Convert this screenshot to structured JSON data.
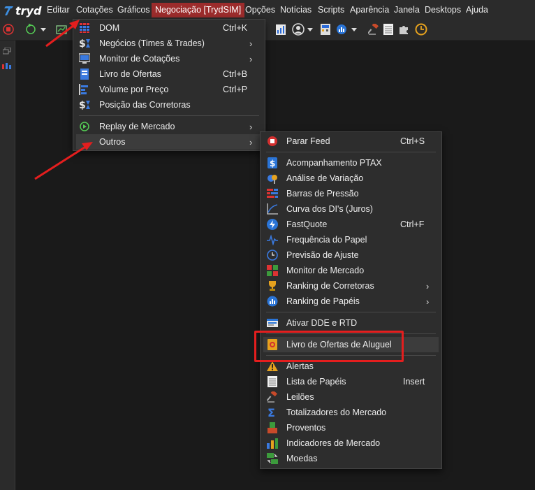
{
  "app": {
    "name": "tryd"
  },
  "menubar": {
    "items": [
      "Editar",
      "Cotações",
      "Gráficos",
      "Negociação [TrydSIM]",
      "Opções",
      "Notícias",
      "Scripts",
      "Aparência",
      "Janela",
      "Desktops",
      "Ajuda"
    ],
    "active_item": "Negociação [TrydSIM]"
  },
  "cotacoes_menu": {
    "items": [
      {
        "label": "DOM",
        "shortcut": "Ctrl+K",
        "icon": "dom-grid-icon"
      },
      {
        "label": "Negócios (Times & Trades)",
        "submenu": true,
        "icon": "dollar-hourglass-icon"
      },
      {
        "label": "Monitor de Cotações",
        "submenu": true,
        "icon": "monitor-icon"
      },
      {
        "label": "Livro de Ofertas",
        "shortcut": "Ctrl+B",
        "icon": "book-icon"
      },
      {
        "label": "Volume por Preço",
        "shortcut": "Ctrl+P",
        "icon": "volume-bars-icon"
      },
      {
        "label": "Posição das Corretoras",
        "icon": "dollar-hourglass-icon"
      },
      {
        "label": "Replay de Mercado",
        "submenu": true,
        "icon": "replay-icon"
      },
      {
        "label": "Outros",
        "submenu": true,
        "icon": ""
      }
    ],
    "highlighted": "Outros"
  },
  "outros_submenu": {
    "items": [
      {
        "label": "Parar Feed",
        "shortcut": "Ctrl+S",
        "icon": "stop-circle-icon"
      },
      {
        "label": "Acompanhamento PTAX",
        "icon": "ptax-dollar-icon"
      },
      {
        "label": "Análise de Variação",
        "icon": "variation-icon"
      },
      {
        "label": "Barras de Pressão",
        "icon": "pressure-bars-icon"
      },
      {
        "label": "Curva dos DI's (Juros)",
        "icon": "curve-icon"
      },
      {
        "label": "FastQuote",
        "shortcut": "Ctrl+F",
        "icon": "lightning-icon"
      },
      {
        "label": "Frequência do Papel",
        "icon": "pulse-icon"
      },
      {
        "label": "Previsão de Ajuste",
        "icon": "clock-icon"
      },
      {
        "label": "Monitor de Mercado",
        "icon": "market-monitor-icon"
      },
      {
        "label": "Ranking de Corretoras",
        "submenu": true,
        "icon": "trophy-icon"
      },
      {
        "label": "Ranking de Papéis",
        "submenu": true,
        "icon": "ranking-badge-icon"
      },
      {
        "label": "Ativar DDE e RTD",
        "icon": "dde-icon"
      },
      {
        "label": "Livro de Ofertas de Aluguel",
        "icon": "rental-book-icon"
      },
      {
        "label": "Alertas",
        "icon": "warning-icon"
      },
      {
        "label": "Lista de Papéis",
        "shortcut": "Insert",
        "icon": "list-icon"
      },
      {
        "label": "Leilões",
        "icon": "gavel-icon"
      },
      {
        "label": "Totalizadores do Mercado",
        "icon": "sigma-icon"
      },
      {
        "label": "Proventos",
        "icon": "proventos-icon"
      },
      {
        "label": "Indicadores de Mercado",
        "icon": "indicators-icon"
      },
      {
        "label": "Moedas",
        "icon": "currency-icon"
      }
    ],
    "highlighted": "Livro de Ofertas de Aluguel"
  },
  "colors": {
    "menubar_bg": "#2b2b2b",
    "menu_bg": "#2d2d2d",
    "active_menu": "#9c2c2c",
    "annotation_red": "#e41e1e",
    "hover": "#3c3c3c"
  }
}
